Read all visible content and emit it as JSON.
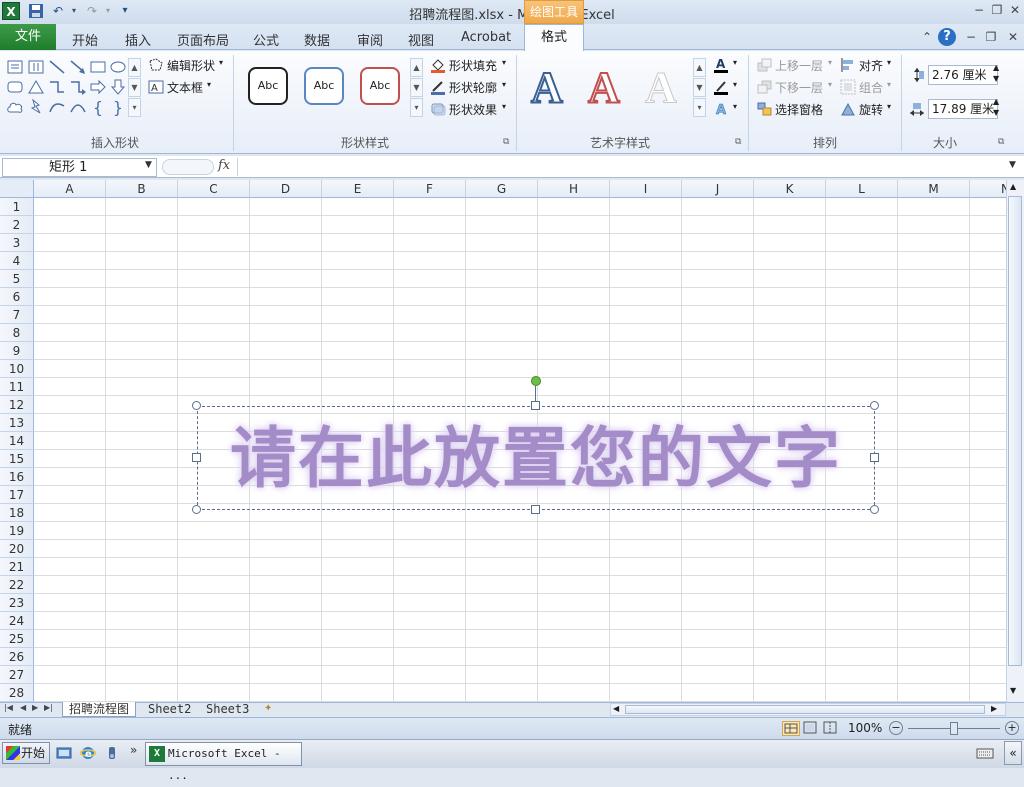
{
  "window": {
    "title": "招聘流程图.xlsx  -  Microsoft Excel",
    "contextual_tab_group": "绘图工具"
  },
  "tabs": {
    "file": "文件",
    "items": [
      "开始",
      "插入",
      "页面布局",
      "公式",
      "数据",
      "审阅",
      "视图",
      "Acrobat"
    ],
    "active": "格式"
  },
  "ribbon": {
    "insert_shapes": {
      "label": "插入形状",
      "edit_shape": "编辑形状",
      "text_box": "文本框"
    },
    "shape_styles": {
      "label": "形状样式",
      "swatch_text": "Abc",
      "fill": "形状填充",
      "outline": "形状轮廓",
      "effects": "形状效果"
    },
    "wordart_styles": {
      "label": "艺术字样式",
      "letter": "A"
    },
    "arrange": {
      "label": "排列",
      "bring_forward": "上移一层",
      "send_backward": "下移一层",
      "selection_pane": "选择窗格",
      "align": "对齐",
      "group": "组合",
      "rotate": "旋转"
    },
    "size": {
      "label": "大小",
      "height": "2.76 厘米",
      "width": "17.89 厘米"
    }
  },
  "formula_bar": {
    "name_box": "矩形  1",
    "fx": "fx",
    "content": ""
  },
  "grid": {
    "columns": [
      "A",
      "B",
      "C",
      "D",
      "E",
      "F",
      "G",
      "H",
      "I",
      "J",
      "K",
      "L",
      "M",
      "N"
    ],
    "rows": [
      "1",
      "2",
      "3",
      "4",
      "5",
      "6",
      "7",
      "8",
      "9",
      "10",
      "11",
      "12",
      "13",
      "14",
      "15",
      "16",
      "17",
      "18",
      "19",
      "20",
      "21",
      "22",
      "23",
      "24",
      "25",
      "26",
      "27",
      "28"
    ]
  },
  "shape": {
    "text": "请在此放置您的文字"
  },
  "sheets": {
    "tabs": [
      "招聘流程图",
      "Sheet2",
      "Sheet3"
    ],
    "active": "招聘流程图"
  },
  "status_bar": {
    "mode": "就绪",
    "zoom": "100%"
  },
  "taskbar": {
    "start": "开始",
    "task_label": "Microsoft Excel - ..."
  },
  "colors": {
    "wordart_text": "#a48cc8",
    "file_tab": "#2a8a38",
    "contextual_tab": "#f0a84a"
  }
}
